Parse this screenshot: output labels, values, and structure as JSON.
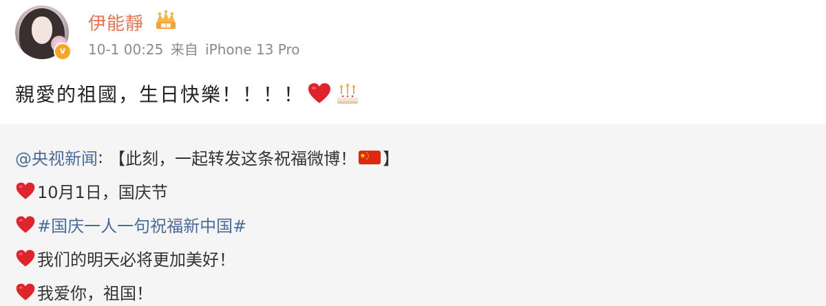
{
  "user": {
    "name": "伊能靜",
    "timestamp": "10-1 00:25",
    "source_prefix": "来自",
    "source_device": "iPhone 13 Pro",
    "verified_mark": "v"
  },
  "post": {
    "text": "親愛的祖國，生日快樂！！！！",
    "emojis": [
      "heart",
      "birthday-cake"
    ]
  },
  "repost": {
    "author": "@央视新闻",
    "colon": ":",
    "title": "【此刻，一起转发这条祝福微博！",
    "title_end": "】",
    "lines": [
      "10月1日，国庆节",
      "#国庆一人一句祝福新中国#",
      "我们的明天必将更加美好！",
      "我爱你，祖国！"
    ]
  },
  "colors": {
    "username": "#eb7350",
    "link": "#4a6c9c",
    "repost_bg": "#f5f5f5",
    "meta": "#8a8a8a"
  }
}
